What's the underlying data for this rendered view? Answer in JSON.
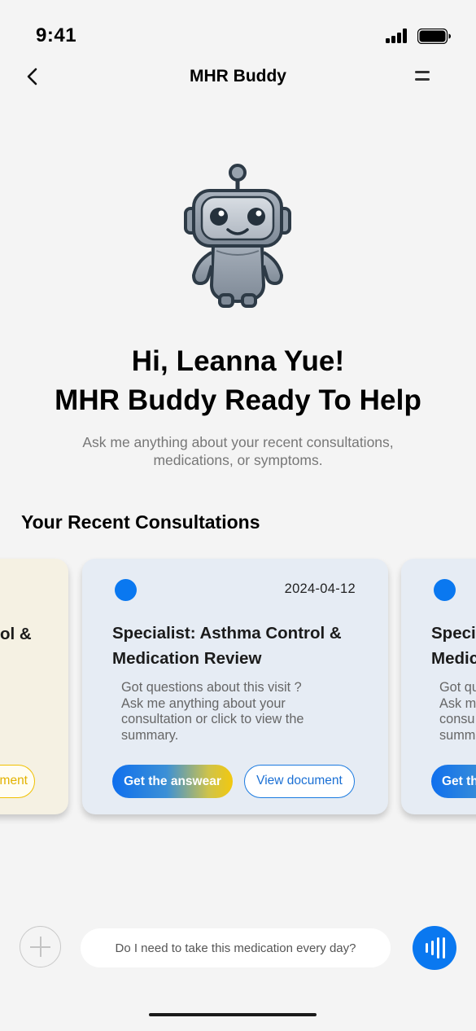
{
  "status_bar": {
    "time": "9:41"
  },
  "header": {
    "title": "MHR Buddy"
  },
  "hero": {
    "greeting_line1": "Hi, Leanna Yue!",
    "greeting_line2": "MHR Buddy Ready To Help",
    "subtitle": "Ask me anything about your recent consultations, medications, or symptoms."
  },
  "consultations": {
    "section_title": "Your Recent Consultations",
    "left_card": {
      "title_fragment": "ol &",
      "button_fragment": "ment",
      "accent_color": "#f0c000"
    },
    "main_card": {
      "date": "2024-04-12",
      "title_line1": "Specialist: Asthma Control &",
      "title_line2": "Medication Review",
      "desc_line1": "Got questions about this visit ?",
      "desc_line2": "Ask me anything about your",
      "desc_line3": "consultation or click to view the",
      "desc_line4": "summary.",
      "primary_button": "Get the answear",
      "secondary_button": "View document",
      "accent_color": "#0a78f0"
    },
    "right_card": {
      "title_line1": "Speci",
      "title_line2": "Medic",
      "desc_line1": "Got qu",
      "desc_line2": "Ask m",
      "desc_line3": "consu",
      "desc_line4": "summ",
      "primary_button": "Get th"
    }
  },
  "composer": {
    "placeholder": "Do I need to take this medication every day?",
    "add_icon": "plus-icon",
    "voice_icon": "voice-wave-icon"
  }
}
